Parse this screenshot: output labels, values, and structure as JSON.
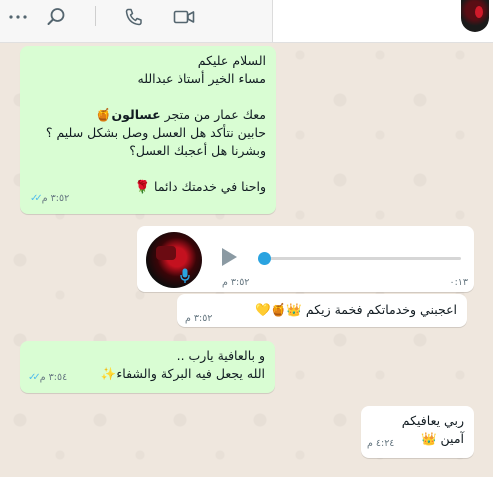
{
  "header": {
    "more_icon": "more-options-icon",
    "search_icon": "search-icon",
    "call_icon": "voice-call-icon",
    "video_icon": "video-call-icon"
  },
  "messages": {
    "m1": {
      "line1": "السلام عليكم",
      "line2": "مساء الخير أستاذ عبدالله",
      "line3_pre": "معك عمار من متجر ",
      "line3_bold": "عسالون",
      "line3_emoji": "🍯",
      "line4": "حابين نتأكد هل العسل وصل بشكل سليم ؟",
      "line5": "وبشرنا هل أعجبك العسل؟",
      "line6": "واحنا في خدمتك دائما",
      "line6_emoji": "🌹",
      "time": "٣:٥٢ م"
    },
    "voice": {
      "duration": "٠:١٣",
      "time": "٣:٥٢ م",
      "progress": 0.0
    },
    "m3": {
      "text": "اعجبني وخدماتكم فخمة زيكم",
      "emojis": "👑🍯💛",
      "time": "٣:٥٢ م"
    },
    "m4": {
      "line1": "و بالعافية يارب ..",
      "line2": "الله يجعل فيه البركة والشفاء",
      "emoji": "✨",
      "time": "٣:٥٤ م"
    },
    "m5": {
      "line1": "ربي يعافيكم",
      "line2": "آمين",
      "emoji": "👑",
      "time": "٤:٢٤ م"
    }
  },
  "colors": {
    "outgoing": "#d9fdd3",
    "incoming": "#ffffff",
    "ticks": "#53bdeb",
    "voice_knob": "#2aa3e0"
  }
}
